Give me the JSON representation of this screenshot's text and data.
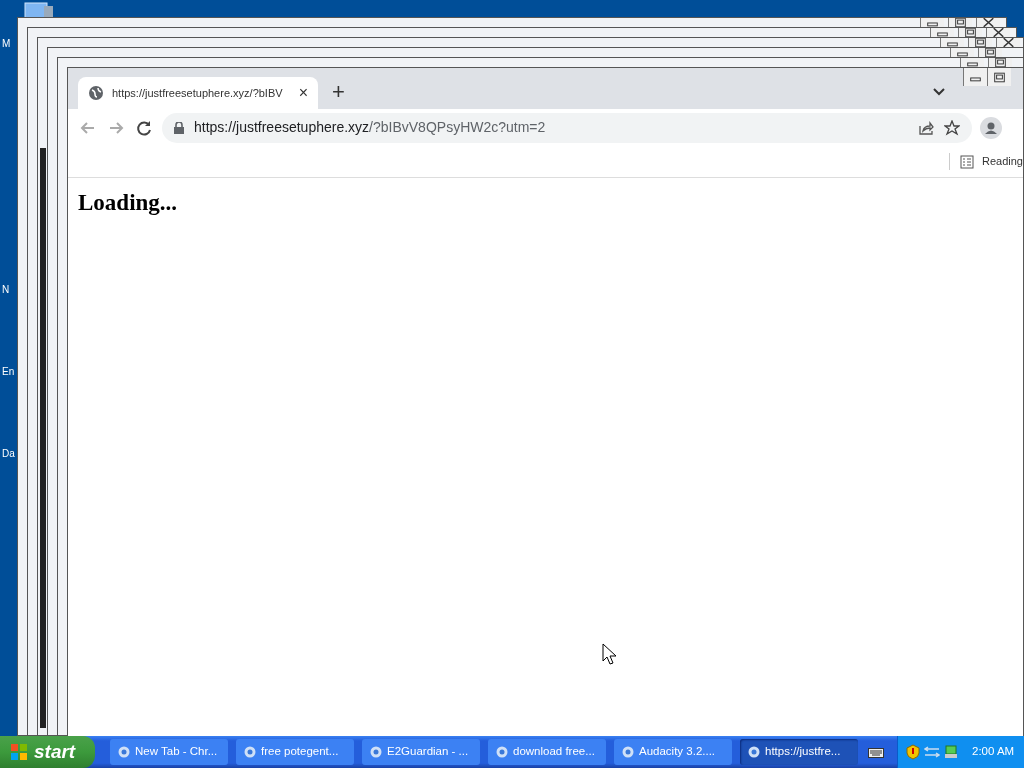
{
  "desktop_icons": [
    {
      "label": "M"
    },
    {
      "label": "N"
    },
    {
      "label": "En"
    },
    {
      "label": "Da"
    }
  ],
  "browser": {
    "tab": {
      "title": "https://justfreesetuphere.xyz/?bIBV",
      "close": "×"
    },
    "new_tab": "+",
    "address": {
      "host": "https://justfreesetuphere.xyz",
      "path": "/?bIBvV8QPsyHW2c?utm=2"
    },
    "reading_list": "Reading",
    "page": {
      "heading": "Loading..."
    }
  },
  "taskbar": {
    "start": "start",
    "tasks": [
      {
        "label": "New Tab - Chr...",
        "selected": false
      },
      {
        "label": "free potegent...",
        "selected": false
      },
      {
        "label": "E2Guardian - ...",
        "selected": false
      },
      {
        "label": "download free...",
        "selected": false
      },
      {
        "label": "Audacity 3.2....",
        "selected": false
      },
      {
        "label": "https://justfre...",
        "selected": true
      }
    ],
    "clock": "2:00 AM"
  }
}
